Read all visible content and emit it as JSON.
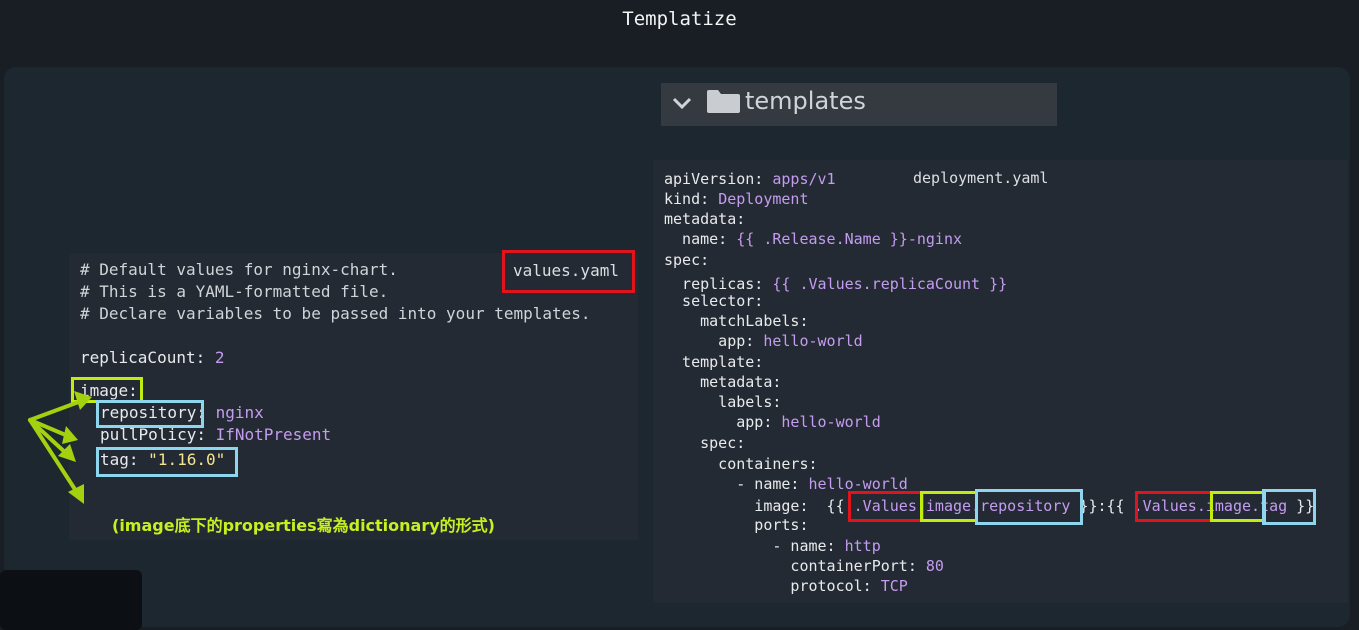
{
  "title": "Templatize",
  "folder": {
    "name": "templates"
  },
  "values_file": {
    "label": "values.yaml",
    "comment1": "# Default values for nginx-chart.",
    "comment2": "# This is a YAML-formatted file.",
    "comment3": "# Declare variables to be passed into your templates.",
    "replica_key": "replicaCount:",
    "replica_val": " 2",
    "image_key": "image:",
    "repository_key": "repository",
    "repository_rest": ": ",
    "repository_val": "nginx",
    "pullpolicy_key": "pullPolicy: ",
    "pullpolicy_val": "IfNotPresent",
    "tag_key": "tag: ",
    "tag_val": "\"1.16.0\""
  },
  "deployment_file": {
    "label": "deployment.yaml",
    "l1k": "apiVersion: ",
    "l1v": "apps/v1",
    "l2k": "kind: ",
    "l2v": "Deployment",
    "l3k": "metadata:",
    "l4k": "  name: ",
    "l4v": "{{ .Release.Name }}-nginx",
    "l5k": "spec:",
    "l6k": "  replicas: ",
    "l6v": "{{ .Values.replicaCount }}",
    "l7k": "  selector:",
    "l8k": "    matchLabels:",
    "l9k": "      app: ",
    "l9v": "hello-world",
    "l10k": "  template:",
    "l11k": "    metadata:",
    "l12k": "      labels:",
    "l13k": "        app: ",
    "l13v": "hello-world",
    "l14k": "    spec:",
    "l15k": "      containers:",
    "l16k": "        - name: ",
    "l16v": "hello-world",
    "l17a": "          image:  {{ ",
    "l17b": ".Values",
    "l17c": ".image",
    "l17d": ".repository",
    "l17e": " }}:{{ ",
    "l17f": ".Values",
    "l17g": ".image",
    "l17h": ".tag",
    "l17i": " }}",
    "l18k": "          ports:",
    "l19k": "            - name: ",
    "l19v": "http",
    "l20k": "              containerPort: ",
    "l20v": "80",
    "l21k": "              protocol: ",
    "l21v": "TCP"
  },
  "annotation_note": "(image底下的properties寫為dictionary的形式)",
  "colors": {
    "red_box": "#e1141c",
    "green_box": "#c1ec12",
    "blue_box": "#8ed6ee",
    "value_purple": "#c49cf0"
  }
}
